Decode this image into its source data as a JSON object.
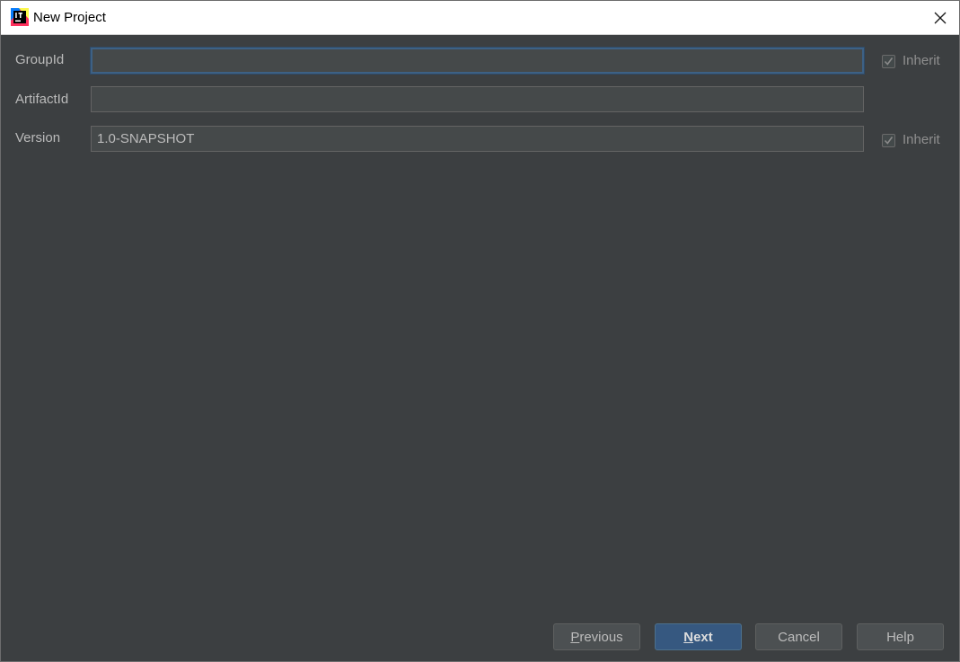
{
  "window": {
    "title": "New Project",
    "close_icon": "close-icon",
    "app_icon": "intellij-idea-icon"
  },
  "form": {
    "group_id": {
      "label": "GroupId",
      "value": "",
      "inherit_label": "Inherit",
      "inherit_checked": true
    },
    "artifact_id": {
      "label": "ArtifactId",
      "value": ""
    },
    "version": {
      "label": "Version",
      "value": "1.0-SNAPSHOT",
      "inherit_label": "Inherit",
      "inherit_checked": true
    }
  },
  "buttons": {
    "previous": {
      "mnemonic": "P",
      "rest": "revious"
    },
    "next": {
      "mnemonic": "N",
      "rest": "ext"
    },
    "cancel": "Cancel",
    "help": "Help"
  },
  "colors": {
    "background": "#3c3f41",
    "field_background": "#45494a",
    "focus_border": "#3d6185",
    "default_button": "#365880",
    "text": "#bbbbbb"
  }
}
